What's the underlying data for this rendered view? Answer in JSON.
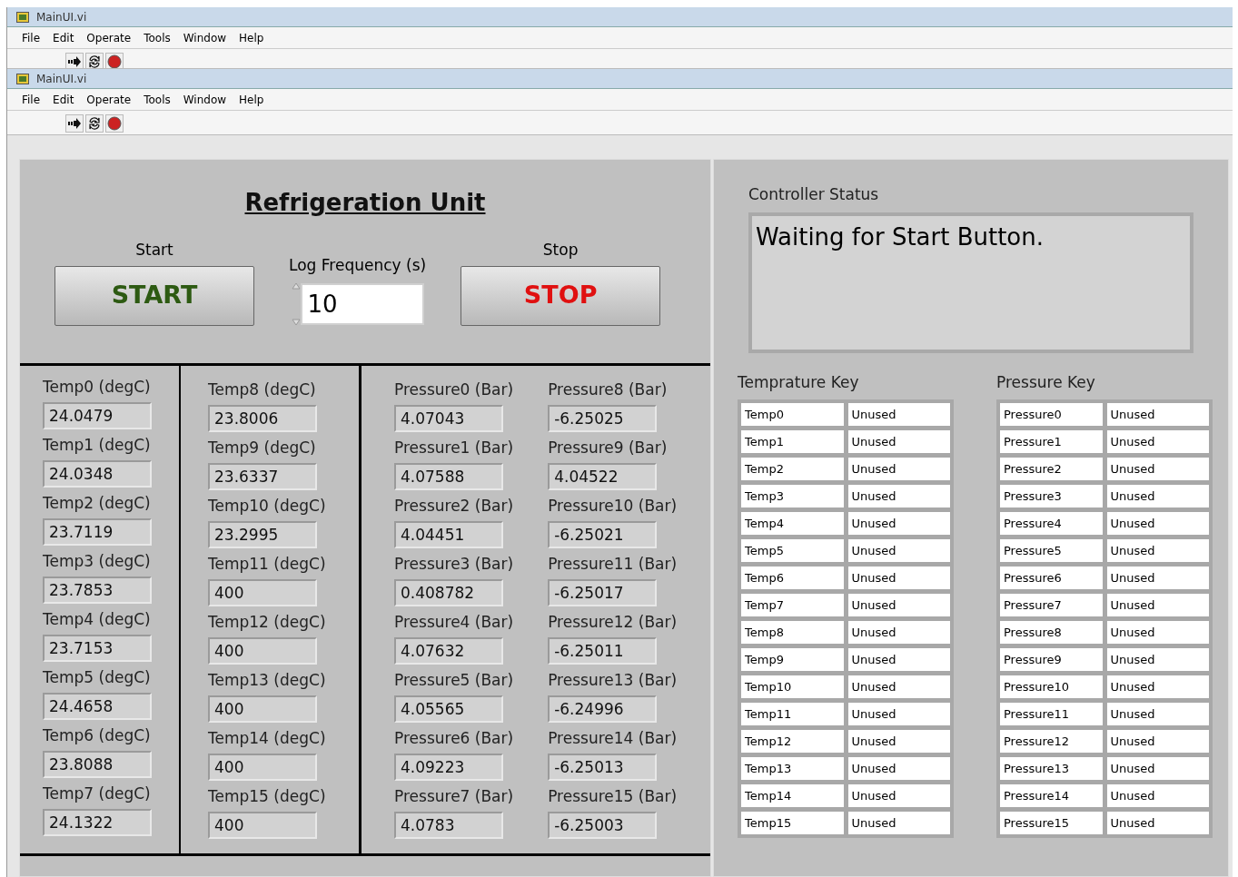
{
  "windows": [
    {
      "title": "MainUI.vi",
      "menu": [
        "File",
        "Edit",
        "Operate",
        "Tools",
        "Window",
        "Help"
      ]
    },
    {
      "title": "MainUI.vi",
      "menu": [
        "File",
        "Edit",
        "Operate",
        "Tools",
        "Window",
        "Help"
      ]
    }
  ],
  "panel": {
    "title": "Refrigeration Unit",
    "start": {
      "label": "Start",
      "button": "START"
    },
    "log_frequency": {
      "label": "Log Frequency (s)",
      "value": "10"
    },
    "stop": {
      "label": "Stop",
      "button": "STOP"
    }
  },
  "temperatures": [
    {
      "label": "Temp0 (degC)",
      "value": "24.0479"
    },
    {
      "label": "Temp1 (degC)",
      "value": "24.0348"
    },
    {
      "label": "Temp2 (degC)",
      "value": "23.7119"
    },
    {
      "label": "Temp3 (degC)",
      "value": "23.7853"
    },
    {
      "label": "Temp4 (degC)",
      "value": "23.7153"
    },
    {
      "label": "Temp5 (degC)",
      "value": "24.4658"
    },
    {
      "label": "Temp6 (degC)",
      "value": "23.8088"
    },
    {
      "label": "Temp7 (degC)",
      "value": "24.1322"
    },
    {
      "label": "Temp8 (degC)",
      "value": "23.8006"
    },
    {
      "label": "Temp9 (degC)",
      "value": "23.6337"
    },
    {
      "label": "Temp10 (degC)",
      "value": "23.2995"
    },
    {
      "label": "Temp11 (degC)",
      "value": "400"
    },
    {
      "label": "Temp12 (degC)",
      "value": "400"
    },
    {
      "label": "Temp13 (degC)",
      "value": "400"
    },
    {
      "label": "Temp14 (degC)",
      "value": "400"
    },
    {
      "label": "Temp15 (degC)",
      "value": "400"
    }
  ],
  "pressures": [
    {
      "label": "Pressure0 (Bar)",
      "value": "4.07043"
    },
    {
      "label": "Pressure1 (Bar)",
      "value": "4.07588"
    },
    {
      "label": "Pressure2 (Bar)",
      "value": "4.04451"
    },
    {
      "label": "Pressure3 (Bar)",
      "value": "0.408782"
    },
    {
      "label": "Pressure4 (Bar)",
      "value": "4.07632"
    },
    {
      "label": "Pressure5 (Bar)",
      "value": "4.05565"
    },
    {
      "label": "Pressure6 (Bar)",
      "value": "4.09223"
    },
    {
      "label": "Pressure7 (Bar)",
      "value": "4.0783"
    },
    {
      "label": "Pressure8 (Bar)",
      "value": "-6.25025"
    },
    {
      "label": "Pressure9 (Bar)",
      "value": "4.04522"
    },
    {
      "label": "Pressure10 (Bar)",
      "value": "-6.25021"
    },
    {
      "label": "Pressure11 (Bar)",
      "value": "-6.25017"
    },
    {
      "label": "Pressure12 (Bar)",
      "value": "-6.25011"
    },
    {
      "label": "Pressure13 (Bar)",
      "value": "-6.24996"
    },
    {
      "label": "Pressure14 (Bar)",
      "value": "-6.25013"
    },
    {
      "label": "Pressure15 (Bar)",
      "value": "-6.25003"
    }
  ],
  "controller_status": {
    "label": "Controller Status",
    "text": "Waiting for Start Button."
  },
  "temperature_key": {
    "title": "Temprature Key",
    "rows": [
      {
        "name": "Temp0",
        "value": "Unused"
      },
      {
        "name": "Temp1",
        "value": "Unused"
      },
      {
        "name": "Temp2",
        "value": "Unused"
      },
      {
        "name": "Temp3",
        "value": "Unused"
      },
      {
        "name": "Temp4",
        "value": "Unused"
      },
      {
        "name": "Temp5",
        "value": "Unused"
      },
      {
        "name": "Temp6",
        "value": "Unused"
      },
      {
        "name": "Temp7",
        "value": "Unused"
      },
      {
        "name": "Temp8",
        "value": "Unused"
      },
      {
        "name": "Temp9",
        "value": "Unused"
      },
      {
        "name": "Temp10",
        "value": "Unused"
      },
      {
        "name": "Temp11",
        "value": "Unused"
      },
      {
        "name": "Temp12",
        "value": "Unused"
      },
      {
        "name": "Temp13",
        "value": "Unused"
      },
      {
        "name": "Temp14",
        "value": "Unused"
      },
      {
        "name": "Temp15",
        "value": "Unused"
      }
    ]
  },
  "pressure_key": {
    "title": "Pressure Key",
    "rows": [
      {
        "name": "Pressure0",
        "value": "Unused"
      },
      {
        "name": "Pressure1",
        "value": "Unused"
      },
      {
        "name": "Pressure2",
        "value": "Unused"
      },
      {
        "name": "Pressure3",
        "value": "Unused"
      },
      {
        "name": "Pressure4",
        "value": "Unused"
      },
      {
        "name": "Pressure5",
        "value": "Unused"
      },
      {
        "name": "Pressure6",
        "value": "Unused"
      },
      {
        "name": "Pressure7",
        "value": "Unused"
      },
      {
        "name": "Pressure8",
        "value": "Unused"
      },
      {
        "name": "Pressure9",
        "value": "Unused"
      },
      {
        "name": "Pressure10",
        "value": "Unused"
      },
      {
        "name": "Pressure11",
        "value": "Unused"
      },
      {
        "name": "Pressure12",
        "value": "Unused"
      },
      {
        "name": "Pressure13",
        "value": "Unused"
      },
      {
        "name": "Pressure14",
        "value": "Unused"
      },
      {
        "name": "Pressure15",
        "value": "Unused"
      }
    ]
  }
}
